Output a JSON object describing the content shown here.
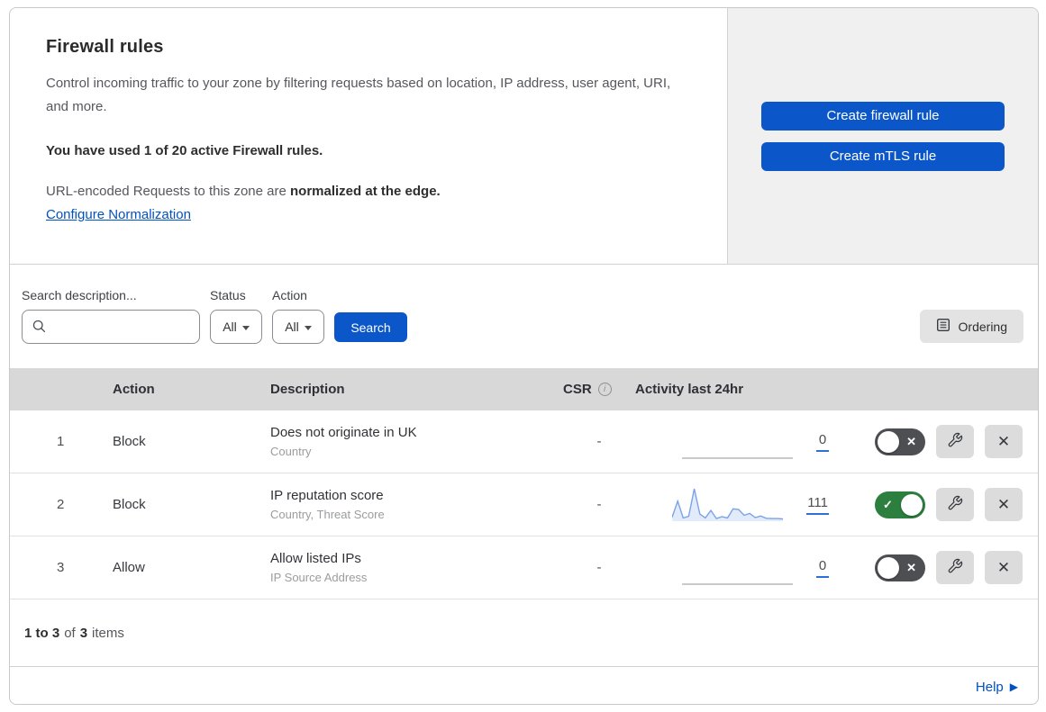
{
  "header": {
    "title": "Firewall rules",
    "description": "Control incoming traffic to your zone by filtering requests based on location, IP address, user agent, URI, and more.",
    "usage_text": "You have used 1 of 20 active Firewall rules.",
    "normalization_prefix": "URL-encoded Requests to this zone are",
    "normalization_bold": "normalized at the edge.",
    "normalization_link": "Configure Normalization",
    "create_firewall_button": "Create firewall rule",
    "create_mtls_button": "Create mTLS rule"
  },
  "filters": {
    "search_label": "Search description...",
    "search_value": "",
    "status_label": "Status",
    "status_value": "All",
    "action_label": "Action",
    "action_value": "All",
    "search_button": "Search",
    "ordering_button": "Ordering"
  },
  "table": {
    "columns": {
      "action": "Action",
      "description": "Description",
      "csr": "CSR",
      "activity": "Activity last 24hr"
    },
    "rows": [
      {
        "num": "1",
        "action": "Block",
        "title": "Does not originate in UK",
        "subtitle": "Country",
        "csr": "-",
        "count": "0",
        "enabled": false,
        "sparkline": []
      },
      {
        "num": "2",
        "action": "Block",
        "title": "IP reputation score",
        "subtitle": "Country, Threat Score",
        "csr": "-",
        "count": "111",
        "enabled": true,
        "sparkline": [
          12,
          62,
          10,
          15,
          100,
          22,
          10,
          33,
          8,
          14,
          10,
          38,
          36,
          18,
          24,
          11,
          16,
          9,
          8,
          8,
          7
        ]
      },
      {
        "num": "3",
        "action": "Allow",
        "title": "Allow listed IPs",
        "subtitle": "IP Source Address",
        "csr": "-",
        "count": "0",
        "enabled": false,
        "sparkline": []
      }
    ]
  },
  "footer": {
    "range": "1 to 3",
    "of_word": "of",
    "total": "3",
    "items_word": "items"
  },
  "help": {
    "label": "Help"
  },
  "icons": {
    "toggle_off_glyph": "✕",
    "toggle_on_glyph": "✓",
    "close_glyph": "✕",
    "help_arrow_glyph": "▶",
    "info_glyph": "i"
  },
  "colors": {
    "accent_blue": "#0b57c9",
    "link_blue": "#0051c3",
    "toggle_green": "#2c7f3f",
    "toggle_off_gray": "#4d4f52",
    "sparkline_blue": "#7ba2e8",
    "header_gray": "#d8d8d9",
    "panel_gray": "#f0f0f1"
  }
}
